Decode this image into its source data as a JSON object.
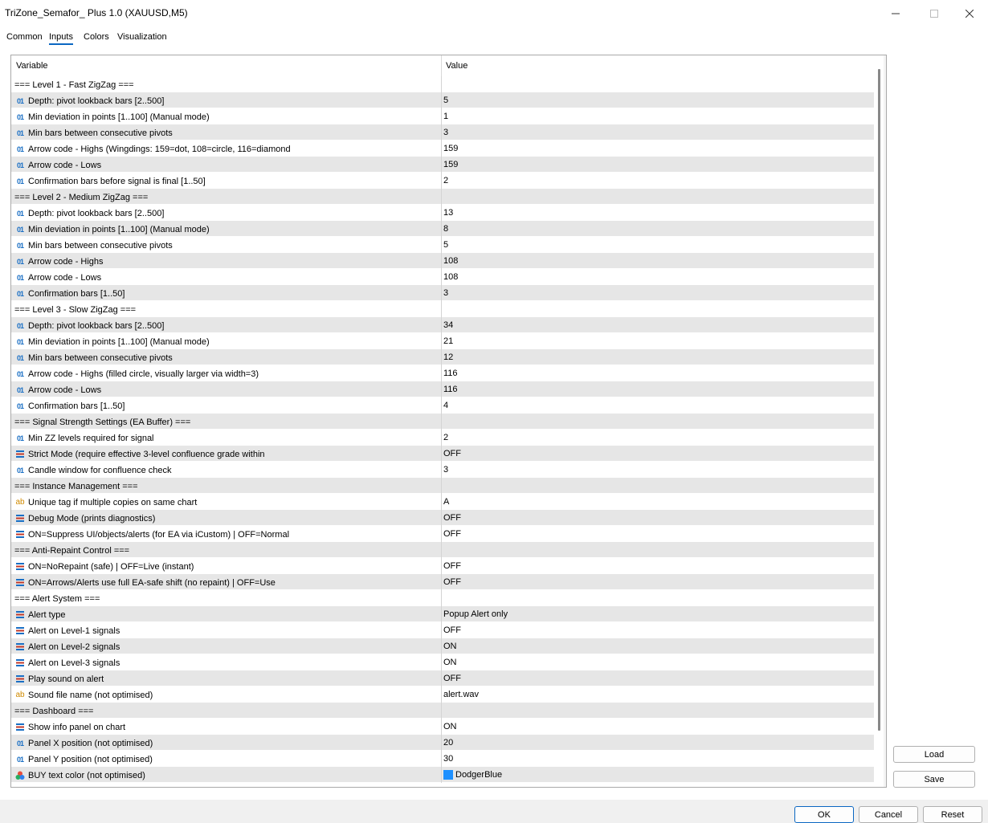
{
  "window": {
    "title": "TriZone_Semafor_ Plus 1.0 (XAUUSD,M5)"
  },
  "tabs": [
    "Common",
    "Inputs",
    "Colors",
    "Visualization"
  ],
  "active_tab": "Inputs",
  "grid": {
    "headers": {
      "variable": "Variable",
      "value": "Value"
    },
    "rows": [
      {
        "t": "sep",
        "label": "=== Level 1 - Fast ZigZag ===",
        "value": ""
      },
      {
        "t": "num",
        "label": "Depth: pivot lookback bars [2..500]",
        "value": "5"
      },
      {
        "t": "num",
        "label": "Min deviation in points [1..100] (Manual mode)",
        "value": "1"
      },
      {
        "t": "num",
        "label": "Min bars between consecutive pivots",
        "value": "3"
      },
      {
        "t": "num",
        "label": "Arrow code - Highs (Wingdings: 159=dot, 108=circle, 116=diamond",
        "value": "159"
      },
      {
        "t": "num",
        "label": "Arrow code - Lows",
        "value": "159"
      },
      {
        "t": "num",
        "label": "Confirmation bars before signal is final [1..50]",
        "value": "2"
      },
      {
        "t": "sep",
        "label": "=== Level 2 - Medium ZigZag ===",
        "value": ""
      },
      {
        "t": "num",
        "label": "Depth: pivot lookback bars [2..500]",
        "value": "13"
      },
      {
        "t": "num",
        "label": "Min deviation in points [1..100] (Manual mode)",
        "value": "8"
      },
      {
        "t": "num",
        "label": "Min bars between consecutive pivots",
        "value": "5"
      },
      {
        "t": "num",
        "label": "Arrow code - Highs",
        "value": "108"
      },
      {
        "t": "num",
        "label": "Arrow code - Lows",
        "value": "108"
      },
      {
        "t": "num",
        "label": "Confirmation bars [1..50]",
        "value": "3"
      },
      {
        "t": "sep",
        "label": "=== Level 3 - Slow ZigZag ===",
        "value": ""
      },
      {
        "t": "num",
        "label": "Depth: pivot lookback bars [2..500]",
        "value": "34"
      },
      {
        "t": "num",
        "label": "Min deviation in points [1..100] (Manual mode)",
        "value": "21"
      },
      {
        "t": "num",
        "label": "Min bars between consecutive pivots",
        "value": "12"
      },
      {
        "t": "num",
        "label": "Arrow code - Highs (filled circle, visually larger via width=3)",
        "value": "116"
      },
      {
        "t": "num",
        "label": "Arrow code - Lows",
        "value": "116"
      },
      {
        "t": "num",
        "label": "Confirmation bars [1..50]",
        "value": "4"
      },
      {
        "t": "sep",
        "label": "=== Signal Strength Settings (EA Buffer) ===",
        "value": ""
      },
      {
        "t": "num",
        "label": "Min ZZ levels required for signal",
        "value": "2"
      },
      {
        "t": "enum",
        "label": "Strict Mode (require effective 3-level confluence grade within",
        "value": "OFF"
      },
      {
        "t": "num",
        "label": "Candle window for confluence check",
        "value": "3"
      },
      {
        "t": "sep",
        "label": "=== Instance Management ===",
        "value": ""
      },
      {
        "t": "str",
        "label": "Unique tag if multiple copies on same chart",
        "value": "A"
      },
      {
        "t": "enum",
        "label": "Debug Mode (prints diagnostics)",
        "value": "OFF"
      },
      {
        "t": "enum",
        "label": "ON=Suppress UI/objects/alerts (for EA via iCustom) | OFF=Normal",
        "value": "OFF"
      },
      {
        "t": "sep",
        "label": "=== Anti-Repaint Control ===",
        "value": ""
      },
      {
        "t": "enum",
        "label": "ON=NoRepaint (safe) | OFF=Live (instant)",
        "value": "OFF"
      },
      {
        "t": "enum",
        "label": "ON=Arrows/Alerts use full EA-safe shift (no repaint) | OFF=Use",
        "value": "OFF"
      },
      {
        "t": "sep",
        "label": "=== Alert System ===",
        "value": ""
      },
      {
        "t": "enum",
        "label": "Alert type",
        "value": "Popup Alert only"
      },
      {
        "t": "enum",
        "label": "Alert on Level-1 signals",
        "value": "OFF"
      },
      {
        "t": "enum",
        "label": "Alert on Level-2 signals",
        "value": "ON"
      },
      {
        "t": "enum",
        "label": "Alert on Level-3 signals",
        "value": "ON"
      },
      {
        "t": "enum",
        "label": "Play sound on alert",
        "value": "OFF"
      },
      {
        "t": "str",
        "label": "Sound file name (not optimised)",
        "value": "alert.wav"
      },
      {
        "t": "sep",
        "label": "=== Dashboard ===",
        "value": ""
      },
      {
        "t": "enum",
        "label": "Show info panel on chart",
        "value": "ON"
      },
      {
        "t": "num",
        "label": "Panel X position (not optimised)",
        "value": "20"
      },
      {
        "t": "num",
        "label": "Panel Y position (not optimised)",
        "value": "30"
      },
      {
        "t": "color",
        "label": "BUY text color (not optimised)",
        "value": "DodgerBlue",
        "color": "#1e90ff"
      }
    ]
  },
  "icons": {
    "num": "01",
    "str": "ab"
  },
  "side_buttons": {
    "load": "Load",
    "save": "Save"
  },
  "footer": {
    "ok": "OK",
    "cancel": "Cancel",
    "reset": "Reset"
  },
  "colors": {
    "accent": "#0b67c2",
    "alt_row": "#e6e6e6",
    "number_icon": "#1a6fc4",
    "string_icon": "#d08a00"
  }
}
